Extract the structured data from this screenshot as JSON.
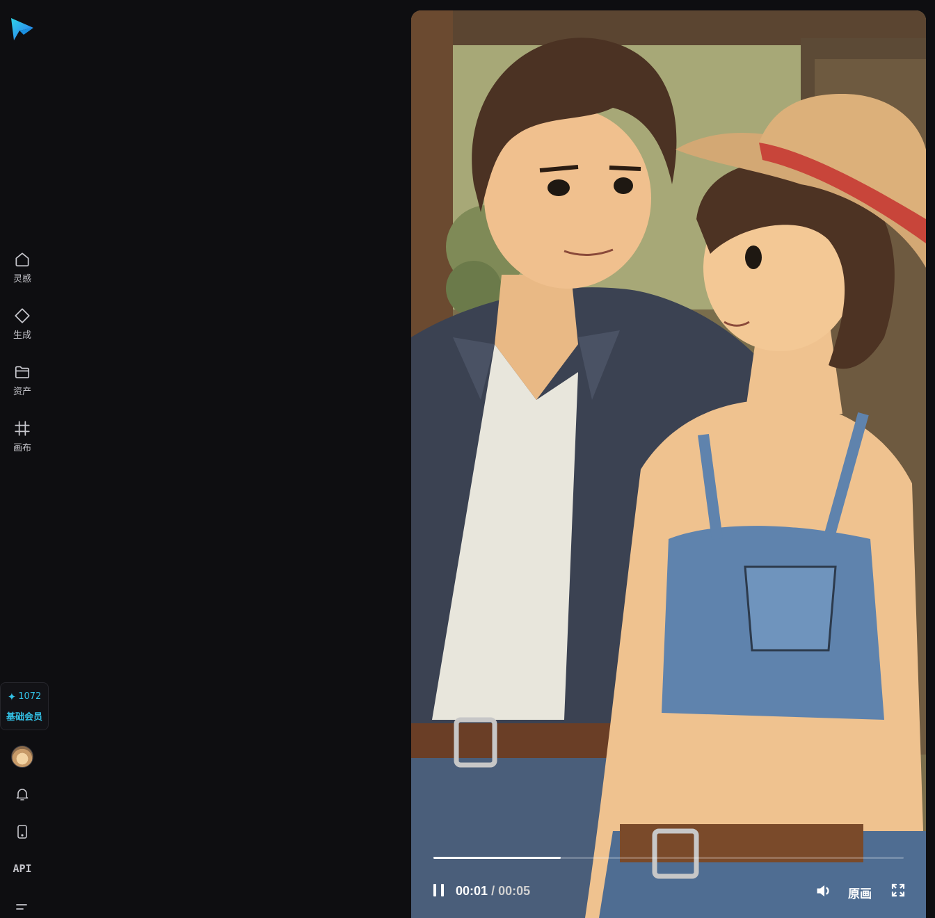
{
  "nav": {
    "items": [
      {
        "label": "灵感",
        "icon": "home-icon"
      },
      {
        "label": "生成",
        "icon": "diamond-icon"
      },
      {
        "label": "资产",
        "icon": "folder-icon"
      },
      {
        "label": "画布",
        "icon": "canvas-icon"
      }
    ]
  },
  "credits": {
    "count": "1072",
    "tier": "基础会员"
  },
  "bottom": {
    "api_label": "API"
  },
  "player": {
    "current_time": "00:01",
    "separator": "/",
    "duration": "00:05",
    "progress": 0.27,
    "quality_label": "原画"
  },
  "colors": {
    "accent": "#33c3e8",
    "background": "#0e0e11"
  }
}
